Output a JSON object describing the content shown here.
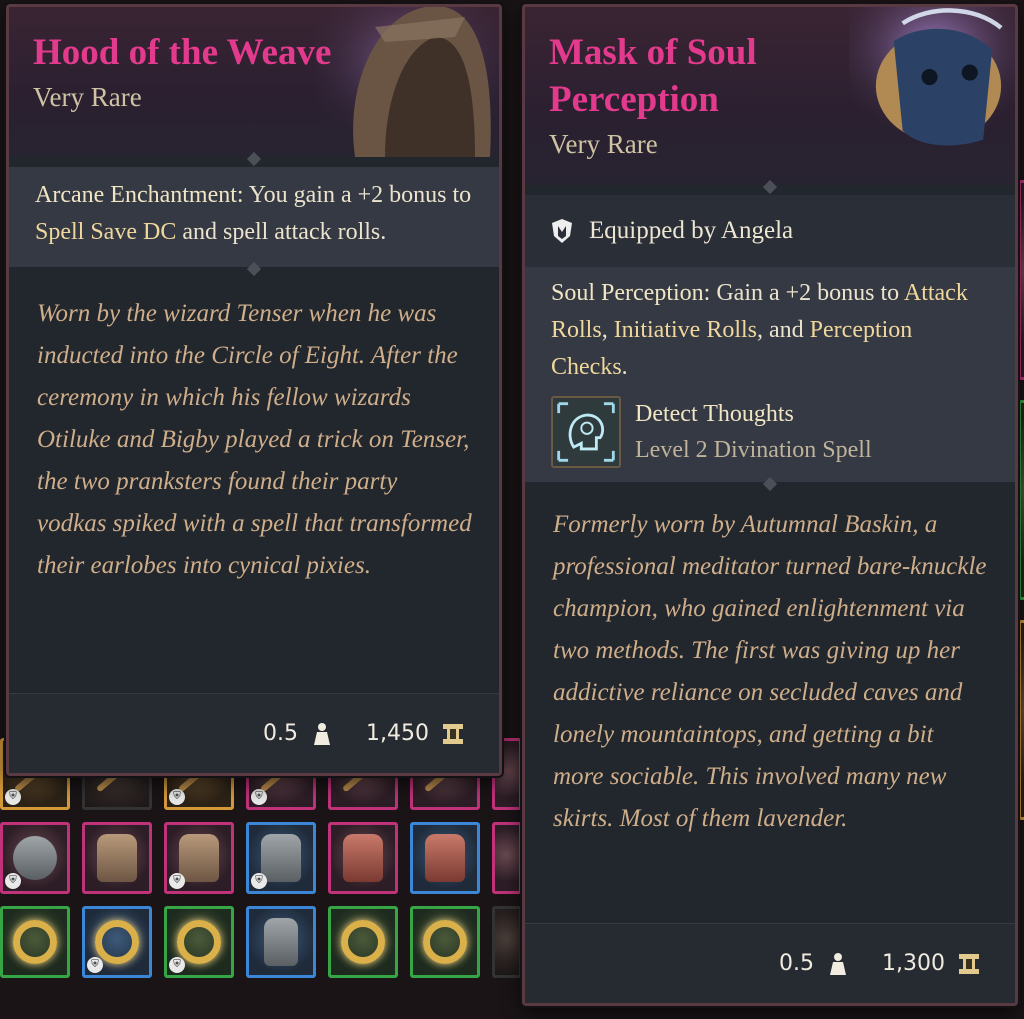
{
  "colors": {
    "item_name": "#e33a8e",
    "rarity": "#cfc3a4",
    "flavor_text": "#cfae8a",
    "rare_border": "#3b86d6",
    "very_rare_border": "#c0327a",
    "uncommon_border": "#36a546"
  },
  "hood": {
    "name": "Hood of the Weave",
    "rarity": "Very Rare",
    "enchant_label": "Arcane Enchantment:",
    "enchant_text_1": " You gain a +2 bonus to ",
    "enchant_kw": "Spell Save DC",
    "enchant_text_2": " and spell attack rolls.",
    "flavor": "Worn by the wizard Tenser when he was inducted into the Circle of Eight. After the ceremony in which his fellow wizards Otiluke and Bigby played a trick on Tenser, the two pranksters found their party vodkas spiked with a spell that transformed their earlobes into cynical pixies.",
    "weight": "0.5",
    "value": "1,450"
  },
  "mask": {
    "name": "Mask of Soul Perception",
    "rarity": "Very Rare",
    "equipped": "Equipped by Angela",
    "ability_label": "Soul Perception:",
    "ability_text_1": " Gain a +2 bonus to ",
    "ability_kw_1": "Attack Rolls",
    "ability_text_2": ", ",
    "ability_kw_2": "Initiative Rolls",
    "ability_text_3": ", and ",
    "ability_kw_3": "Perception Checks",
    "ability_text_4": ".",
    "spell_name": "Detect Thoughts",
    "spell_level": "Level 2 Divination Spell",
    "flavor": "Formerly worn by Autumnal Baskin, a professional meditator turned bare-knuckle champion, who gained enlightenment via two methods. The first was giving up her addictive reliance on secluded caves and lonely mountaintops, and getting a bit more sociable. This involved many new skirts. Most of them lavender.",
    "weight": "0.5",
    "value": "1,300"
  },
  "icons": [
    "weight-icon",
    "gold-coin-icon",
    "equipped-shield-icon",
    "detect-thoughts-spell-icon"
  ]
}
